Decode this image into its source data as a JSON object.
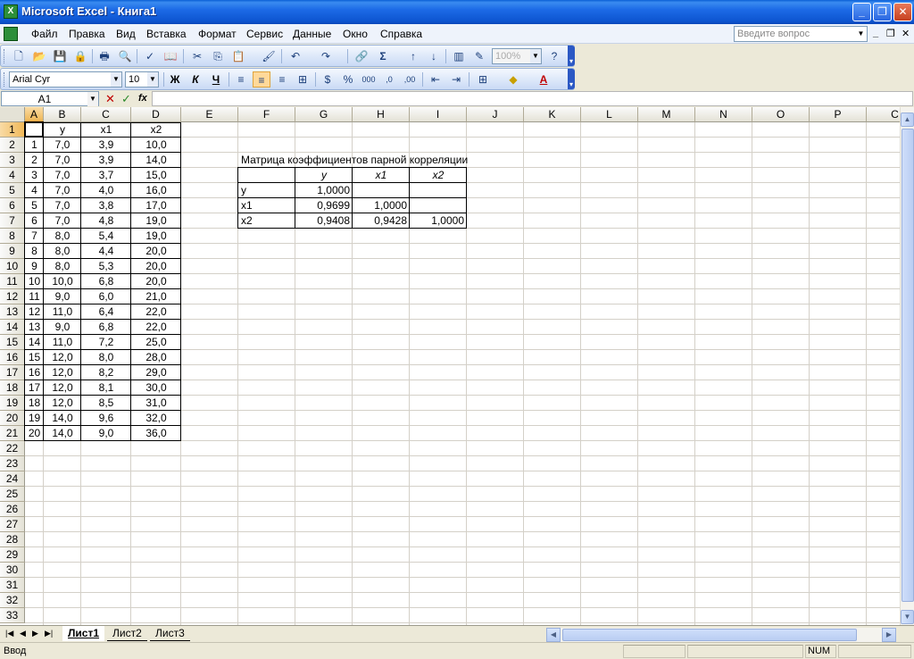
{
  "window": {
    "title": "Microsoft Excel - Книга1",
    "minimize": "_",
    "restore": "❐",
    "close": "✕"
  },
  "menu": {
    "items": [
      {
        "label": "Файл"
      },
      {
        "label": "Правка"
      },
      {
        "label": "Вид"
      },
      {
        "label": "Вставка"
      },
      {
        "label": "Формат"
      },
      {
        "label": "Сервис"
      },
      {
        "label": "Данные"
      },
      {
        "label": "Окно"
      },
      {
        "label": "Справка"
      }
    ],
    "help_placeholder": "Введите вопрос"
  },
  "toolbar": {
    "zoom": "100%",
    "font_name": "Arial Cyr",
    "font_size": "10",
    "bold": "Ж",
    "italic": "К",
    "underline": "Ч",
    "sum": "Σ"
  },
  "formula_bar": {
    "name_box": "A1",
    "fx": "fx",
    "value": ""
  },
  "columns": [
    "A",
    "B",
    "C",
    "D",
    "E",
    "F",
    "G",
    "H",
    "I",
    "J",
    "K",
    "L",
    "M",
    "N",
    "O",
    "P",
    "C"
  ],
  "rows": [
    "1",
    "2",
    "3",
    "4",
    "5",
    "6",
    "7",
    "8",
    "9",
    "10",
    "11",
    "12",
    "13",
    "14",
    "15",
    "16",
    "17",
    "18",
    "19",
    "20",
    "21",
    "22",
    "23",
    "24",
    "25",
    "26",
    "27",
    "28",
    "29",
    "30",
    "31",
    "32",
    "33"
  ],
  "data_table": {
    "headers": [
      "",
      "y",
      "x1",
      "x2"
    ],
    "rows": [
      [
        "1",
        "7,0",
        "3,9",
        "10,0"
      ],
      [
        "2",
        "7,0",
        "3,9",
        "14,0"
      ],
      [
        "3",
        "7,0",
        "3,7",
        "15,0"
      ],
      [
        "4",
        "7,0",
        "4,0",
        "16,0"
      ],
      [
        "5",
        "7,0",
        "3,8",
        "17,0"
      ],
      [
        "6",
        "7,0",
        "4,8",
        "19,0"
      ],
      [
        "7",
        "8,0",
        "5,4",
        "19,0"
      ],
      [
        "8",
        "8,0",
        "4,4",
        "20,0"
      ],
      [
        "9",
        "8,0",
        "5,3",
        "20,0"
      ],
      [
        "10",
        "10,0",
        "6,8",
        "20,0"
      ],
      [
        "11",
        "9,0",
        "6,0",
        "21,0"
      ],
      [
        "12",
        "11,0",
        "6,4",
        "22,0"
      ],
      [
        "13",
        "9,0",
        "6,8",
        "22,0"
      ],
      [
        "14",
        "11,0",
        "7,2",
        "25,0"
      ],
      [
        "15",
        "12,0",
        "8,0",
        "28,0"
      ],
      [
        "16",
        "12,0",
        "8,2",
        "29,0"
      ],
      [
        "17",
        "12,0",
        "8,1",
        "30,0"
      ],
      [
        "18",
        "12,0",
        "8,5",
        "31,0"
      ],
      [
        "19",
        "14,0",
        "9,6",
        "32,0"
      ],
      [
        "20",
        "14,0",
        "9,0",
        "36,0"
      ]
    ]
  },
  "correlation": {
    "title": "Матрица коэффициентов парной корреляции",
    "headers": [
      "",
      "y",
      "x1",
      "x2"
    ],
    "rows": [
      [
        "y",
        "1,0000",
        "",
        ""
      ],
      [
        "x1",
        "0,9699",
        "1,0000",
        ""
      ],
      [
        "x2",
        "0,9408",
        "0,9428",
        "1,0000"
      ]
    ]
  },
  "sheets": [
    {
      "label": "Лист1"
    },
    {
      "label": "Лист2"
    },
    {
      "label": "Лист3"
    }
  ],
  "status": {
    "mode": "Ввод",
    "num": "NUM"
  }
}
